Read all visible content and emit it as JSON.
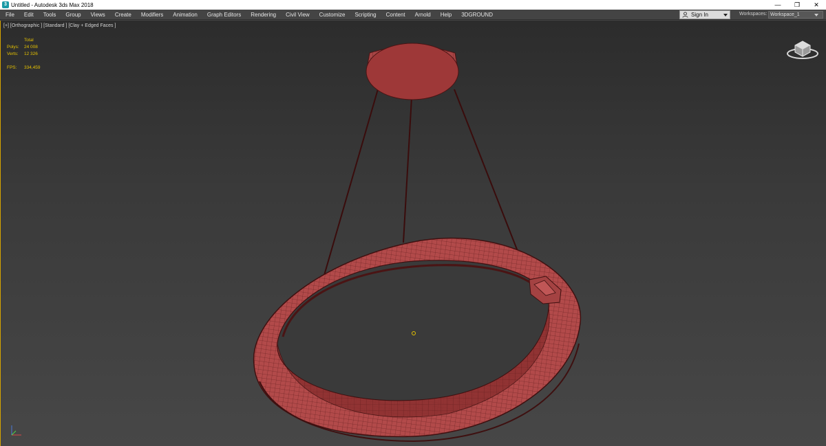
{
  "window": {
    "title": "Untitled - Autodesk 3ds Max 2018",
    "app_icon": "3dsmax-logo-icon",
    "controls": [
      "minimize-icon",
      "restore-icon",
      "close-icon"
    ],
    "control_glyphs": [
      "—",
      "❐",
      "✕"
    ]
  },
  "menu": {
    "items": [
      "File",
      "Edit",
      "Tools",
      "Group",
      "Views",
      "Create",
      "Modifiers",
      "Animation",
      "Graph Editors",
      "Rendering",
      "Civil View",
      "Customize",
      "Scripting",
      "Content",
      "Arnold",
      "Help",
      "3DGROUND"
    ],
    "signin_label": "Sign In",
    "workspaces_label": "Workspaces:",
    "workspace_value": "Workspace_1"
  },
  "viewport": {
    "label": "[+] [Orthographic ] [Standard ] [Clay + Edged Faces ]",
    "stats": {
      "header": "Total",
      "polys_label": "Polys:",
      "polys_value": "24 008",
      "verts_label": "Verts:",
      "verts_value": "12 326",
      "fps_label": "FPS:",
      "fps_value": "334,459"
    },
    "model": "pendant-ring-lamp",
    "colors": {
      "mesh": "#b24a4a",
      "mesh_dark": "#7a2a2a",
      "wire": "#4a1414",
      "stats": "#e6c200",
      "active_border": "#d6a400"
    }
  }
}
